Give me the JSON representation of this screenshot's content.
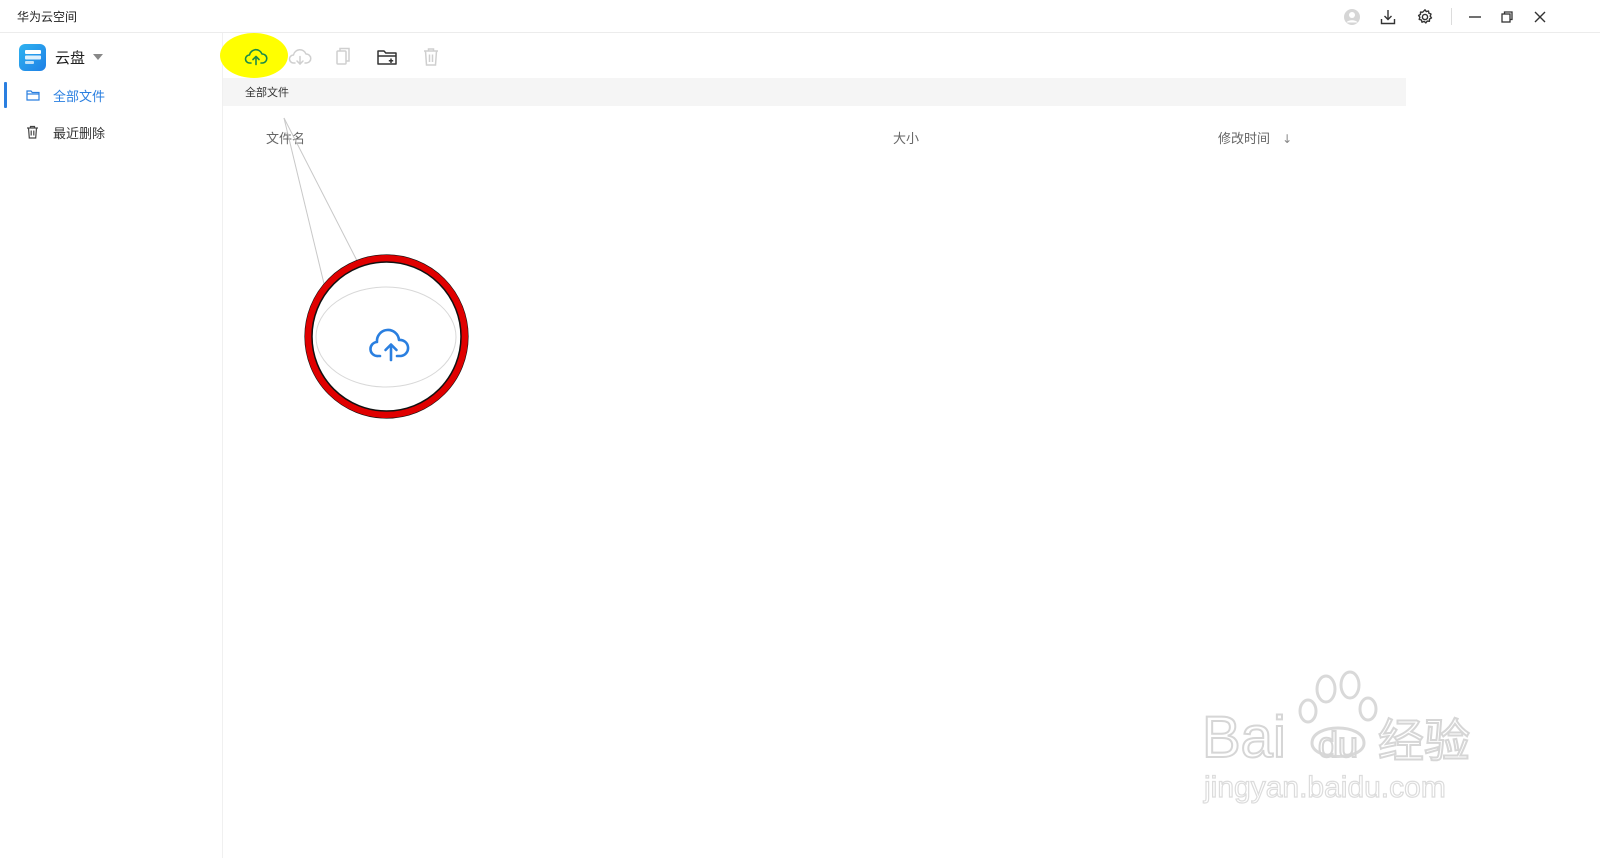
{
  "window": {
    "title": "华为云空间",
    "icons": [
      "account-icon",
      "download-icon",
      "settings-icon",
      "minimize-icon",
      "restore-icon",
      "close-icon"
    ]
  },
  "sidebar": {
    "brand_name": "云盘",
    "items": [
      {
        "label": "全部文件",
        "icon": "folder-icon",
        "active": true
      },
      {
        "label": "最近删除",
        "icon": "trash-icon",
        "active": false
      }
    ]
  },
  "toolbar": {
    "tools": [
      {
        "name": "upload",
        "icon": "cloud-upload-icon",
        "enabled": true,
        "highlighted": true
      },
      {
        "name": "download",
        "icon": "cloud-download-icon",
        "enabled": false
      },
      {
        "name": "copy",
        "icon": "copy-icon",
        "enabled": false
      },
      {
        "name": "new-folder",
        "icon": "new-folder-icon",
        "enabled": true
      },
      {
        "name": "delete",
        "icon": "delete-icon",
        "enabled": false
      }
    ]
  },
  "breadcrumb": "全部文件",
  "table": {
    "columns": [
      "文件名",
      "大小",
      "修改时间"
    ],
    "sort_indicator": "↓",
    "rows": []
  },
  "annotation": {
    "icon": "cloud-upload-icon",
    "ring_color": "#e00000",
    "highlight_color": "#ffff00"
  },
  "watermark": {
    "brand": "Bai du 经验",
    "url": "jingyan.baidu.com"
  },
  "colors": {
    "accent": "#2a7fe0",
    "upload_icon": "#1a8a4a"
  }
}
